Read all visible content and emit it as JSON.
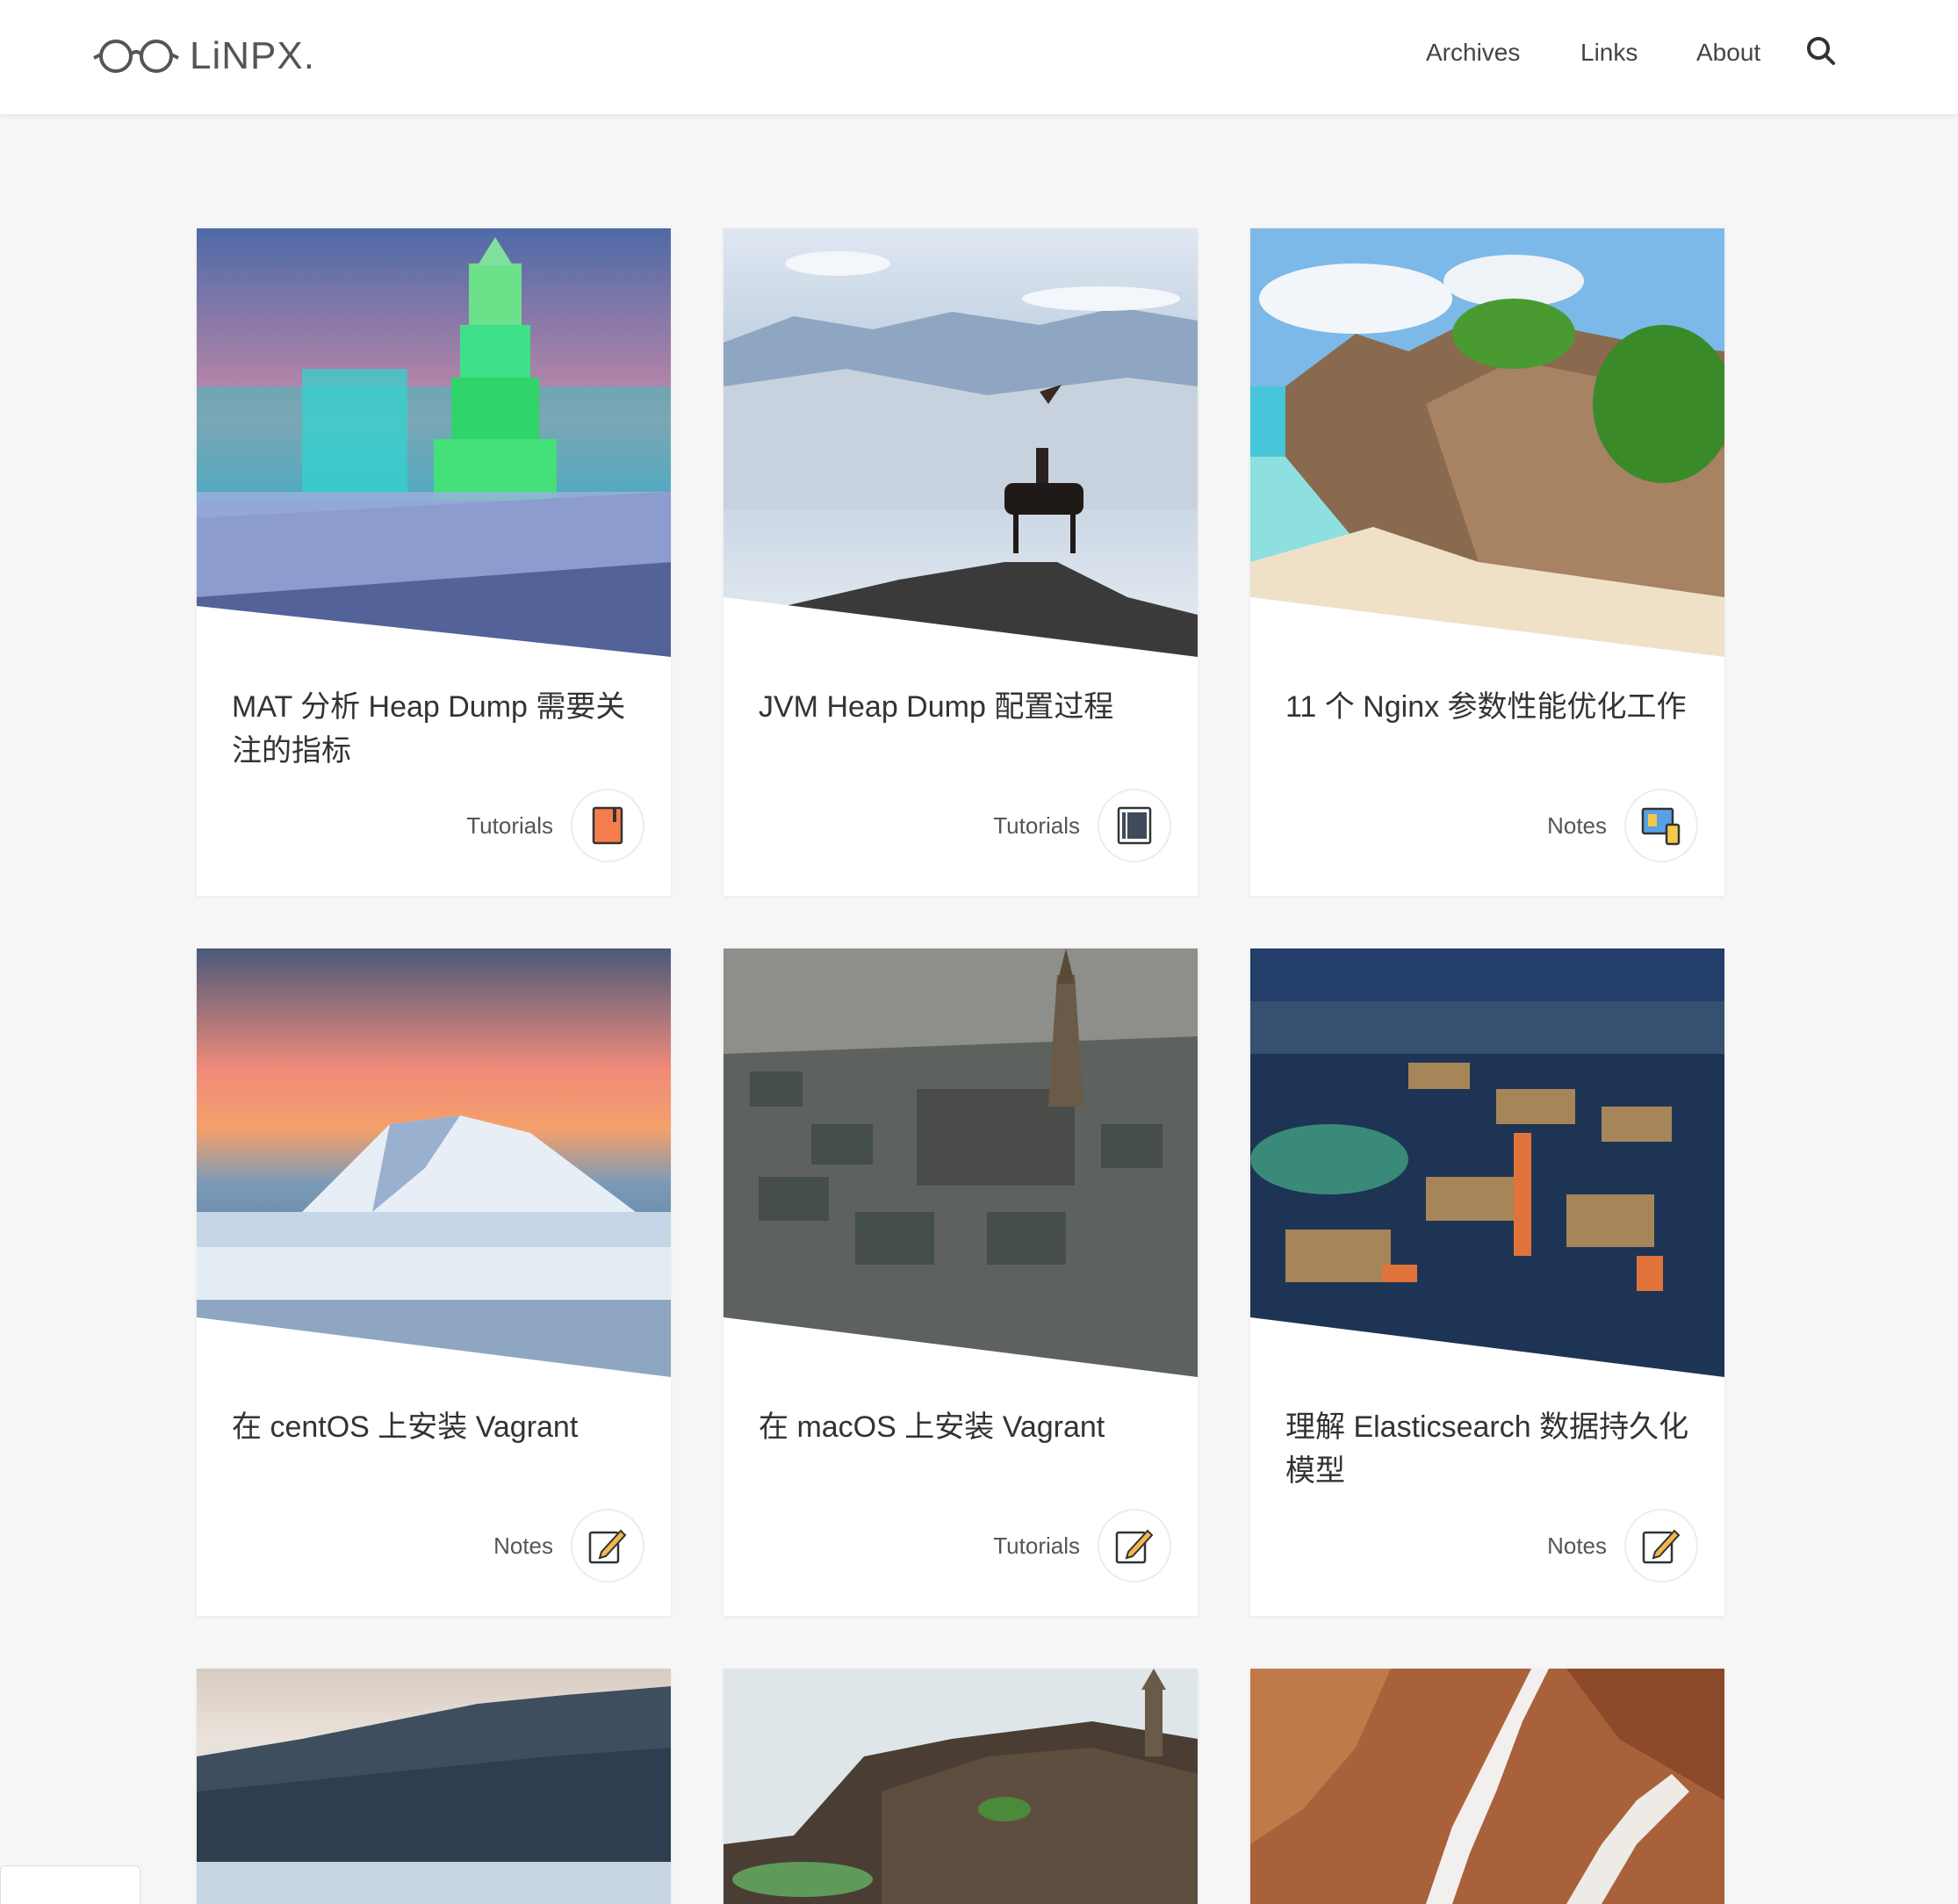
{
  "site": {
    "logo_text": "LiNPX."
  },
  "nav": {
    "items": [
      "Archives",
      "Links",
      "About"
    ]
  },
  "posts": [
    {
      "title": "MAT 分析 Heap Dump 需要关注的指标",
      "category": "Tutorials",
      "icon": "notebook-icon",
      "image": "harbin-ice-pagoda"
    },
    {
      "title": "JVM Heap Dump 配置过程",
      "category": "Tutorials",
      "icon": "document-icon",
      "image": "eagle-hunter-snow"
    },
    {
      "title": "11 个 Nginx 参数性能优化工作",
      "category": "Notes",
      "icon": "devices-icon",
      "image": "tropical-granite-beach"
    },
    {
      "title": "在 centOS 上安装 Vagrant",
      "category": "Notes",
      "icon": "edit-icon",
      "image": "mountain-above-clouds"
    },
    {
      "title": "在 macOS 上安装 Vagrant",
      "category": "Tutorials",
      "icon": "edit-icon",
      "image": "city-model-cathedral"
    },
    {
      "title": "理解 Elasticsearch 数据持久化模型",
      "category": "Notes",
      "icon": "edit-icon",
      "image": "city-aerial-night"
    },
    {
      "title": "",
      "category": "",
      "icon": "",
      "image": "forest-hills-fog"
    },
    {
      "title": "",
      "category": "",
      "icon": "",
      "image": "karst-pagoda-hill"
    },
    {
      "title": "",
      "category": "",
      "icon": "",
      "image": "desert-aerial"
    }
  ]
}
